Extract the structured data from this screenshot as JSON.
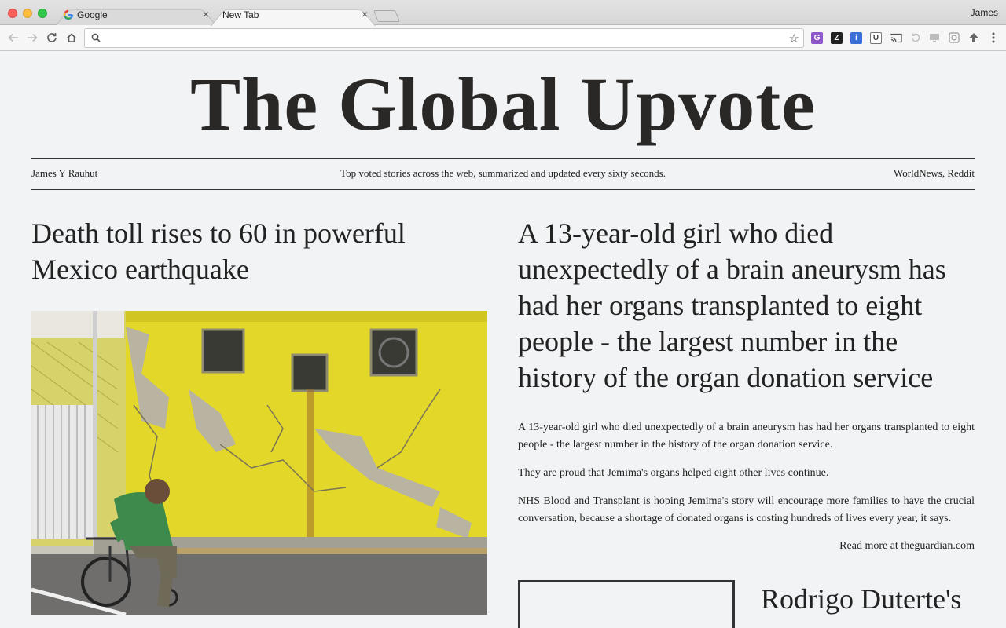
{
  "browser": {
    "tabs": [
      {
        "label": "Google"
      },
      {
        "label": "New Tab"
      }
    ],
    "close_glyph": "×",
    "profile_name": "James",
    "omnibox": {
      "value": "",
      "placeholder": ""
    },
    "toolbar_icons": [
      "back-arrow-icon",
      "forward-arrow-icon",
      "reload-icon",
      "home-icon",
      "search-icon",
      "bookmark-star-icon",
      "more-menu-icon"
    ],
    "extensions": [
      {
        "name": "g-extension-icon",
        "glyph": "G",
        "color": "#8e57c9"
      },
      {
        "name": "z-extension-icon",
        "glyph": "Z",
        "color": "#222222"
      },
      {
        "name": "info-extension-icon",
        "glyph": "i",
        "color": "#3a6fd8"
      },
      {
        "name": "u-extension-icon",
        "glyph": "U",
        "color": "#ffffff"
      }
    ]
  },
  "page": {
    "masthead": "The Global Upvote",
    "meta": {
      "author": "James Y Rauhut",
      "tagline": "Top voted stories across the web, summarized and updated every sixty seconds.",
      "sources": "WorldNews, Reddit"
    },
    "lead_story": {
      "headline": "Death toll rises to 60 in powerful Mexico earthquake"
    },
    "story2": {
      "headline": "A 13-year-old girl who died unexpectedly of a brain aneurysm has had her organs transplanted to eight people - the largest number in the history of the organ donation service",
      "paragraphs": [
        "A 13-year-old girl who died unexpectedly of a brain aneurysm has had her organs transplanted to eight people - the largest number in the history of the organ donation service.",
        "They are proud that Jemima's organs helped eight other lives continue.",
        "NHS Blood and Transplant is hoping Jemima's story will encourage more families to have the crucial conversation, because a shortage of donated organs is costing hundreds of lives every year, it says."
      ],
      "read_more": "Read more at theguardian.com"
    },
    "story3": {
      "headline": "Rodrigo Duterte's"
    },
    "colors": {
      "background": "#f2f3f4",
      "text": "#222222",
      "photo_wall": "#e3d82a"
    }
  }
}
